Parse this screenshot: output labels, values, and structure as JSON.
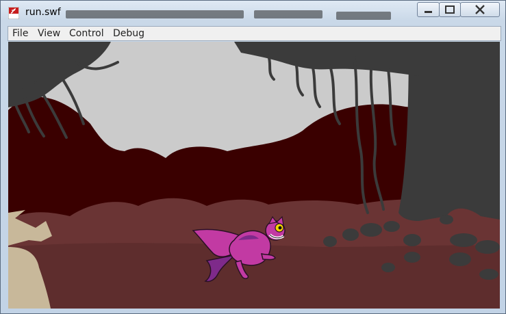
{
  "window": {
    "title": "run.swf",
    "app_icon": "flash-player-icon"
  },
  "controls": {
    "minimize": "minimize-icon",
    "maximize": "maximize-icon",
    "close": "close-icon"
  },
  "menu": {
    "items": [
      "File",
      "View",
      "Control",
      "Debug"
    ]
  },
  "scene": {
    "description_icons": [
      "tree-icon",
      "cat-character-icon"
    ],
    "colors": {
      "sky": "#cbcbcb",
      "hills": "#3a0000",
      "ground": "#6a3434",
      "tree": "#3b3b3b",
      "cat": "#c23aa3"
    }
  }
}
